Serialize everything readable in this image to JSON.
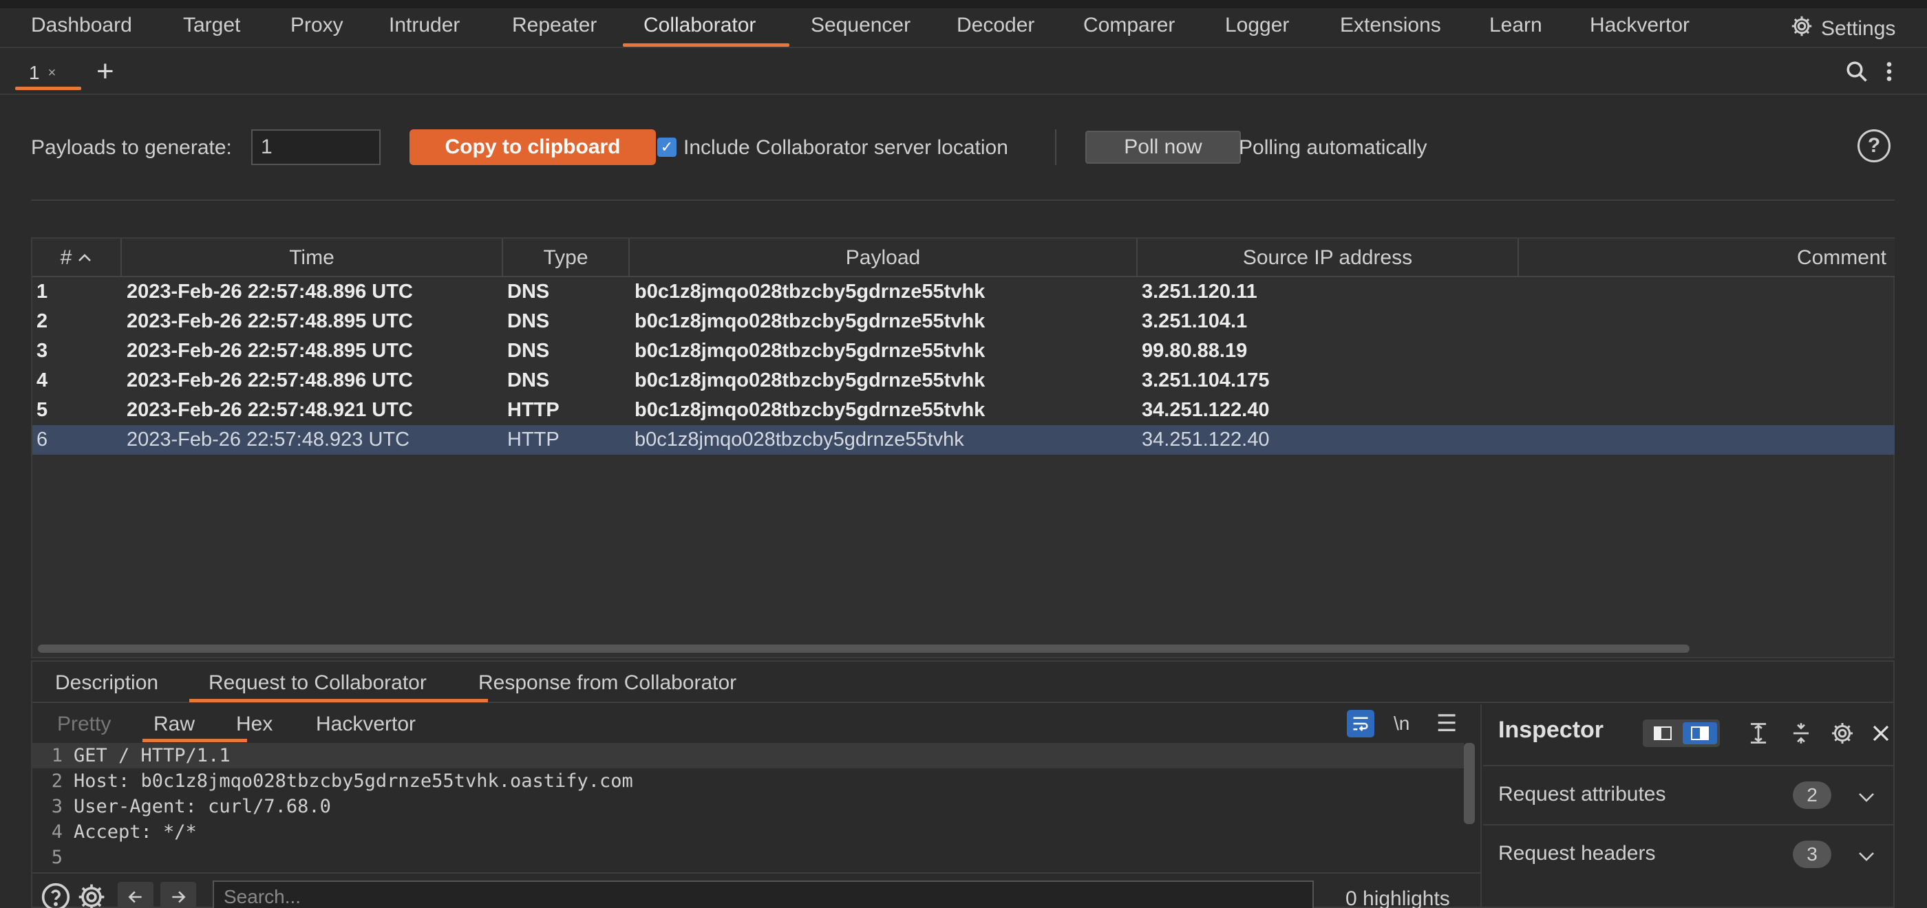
{
  "nav": {
    "tabs": [
      {
        "label": "Dashboard"
      },
      {
        "label": "Target"
      },
      {
        "label": "Proxy"
      },
      {
        "label": "Intruder"
      },
      {
        "label": "Repeater"
      },
      {
        "label": "Collaborator"
      },
      {
        "label": "Sequencer"
      },
      {
        "label": "Decoder"
      },
      {
        "label": "Comparer"
      },
      {
        "label": "Logger"
      },
      {
        "label": "Extensions"
      },
      {
        "label": "Learn"
      },
      {
        "label": "Hackvertor"
      }
    ],
    "active": "Collaborator",
    "settings_label": "Settings"
  },
  "subtab": {
    "label": "1",
    "close": "×",
    "add": "+"
  },
  "toolbar": {
    "payloads_label": "Payloads to generate:",
    "payloads_value": "1",
    "copy_label": "Copy to clipboard",
    "include_label": "Include Collaborator server location",
    "include_checked": true,
    "poll_label": "Poll now",
    "polling_status": "Polling automatically",
    "help": "?"
  },
  "table": {
    "columns": [
      "#",
      "Time",
      "Type",
      "Payload",
      "Source IP address",
      "Comment"
    ],
    "rows": [
      {
        "num": "1",
        "time": "2023-Feb-26 22:57:48.896 UTC",
        "type": "DNS",
        "payload": "b0c1z8jmqo028tbzcby5gdrnze55tvhk",
        "ip": "3.251.120.11",
        "comment": ""
      },
      {
        "num": "2",
        "time": "2023-Feb-26 22:57:48.895 UTC",
        "type": "DNS",
        "payload": "b0c1z8jmqo028tbzcby5gdrnze55tvhk",
        "ip": "3.251.104.1",
        "comment": ""
      },
      {
        "num": "3",
        "time": "2023-Feb-26 22:57:48.895 UTC",
        "type": "DNS",
        "payload": "b0c1z8jmqo028tbzcby5gdrnze55tvhk",
        "ip": "99.80.88.19",
        "comment": ""
      },
      {
        "num": "4",
        "time": "2023-Feb-26 22:57:48.896 UTC",
        "type": "DNS",
        "payload": "b0c1z8jmqo028tbzcby5gdrnze55tvhk",
        "ip": "3.251.104.175",
        "comment": ""
      },
      {
        "num": "5",
        "time": "2023-Feb-26 22:57:48.921 UTC",
        "type": "HTTP",
        "payload": "b0c1z8jmqo028tbzcby5gdrnze55tvhk",
        "ip": "34.251.122.40",
        "comment": ""
      },
      {
        "num": "6",
        "time": "2023-Feb-26 22:57:48.923 UTC",
        "type": "HTTP",
        "payload": "b0c1z8jmqo028tbzcby5gdrnze55tvhk",
        "ip": "34.251.122.40",
        "comment": ""
      }
    ]
  },
  "details": {
    "tabs": [
      "Description",
      "Request to Collaborator",
      "Response from Collaborator"
    ],
    "active": "Request to Collaborator"
  },
  "editor": {
    "tabs": [
      "Pretty",
      "Raw",
      "Hex",
      "Hackvertor"
    ],
    "active": "Raw",
    "newline_toggle": "\\n",
    "lines": [
      {
        "n": "1",
        "text": "GET / HTTP/1.1"
      },
      {
        "n": "2",
        "text": "Host: b0c1z8jmqo028tbzcby5gdrnze55tvhk.oastify.com"
      },
      {
        "n": "3",
        "text": "User-Agent: curl/7.68.0"
      },
      {
        "n": "4",
        "text": "Accept: */*"
      },
      {
        "n": "5",
        "text": ""
      }
    ],
    "search_placeholder": "Search...",
    "highlights": "0 highlights"
  },
  "inspector": {
    "title": "Inspector",
    "sections": [
      {
        "label": "Request attributes",
        "count": "2"
      },
      {
        "label": "Request headers",
        "count": "3"
      }
    ]
  },
  "colors": {
    "accent": "#e8773a",
    "selection": "#3c4a63",
    "primary_button": "#e2642f",
    "blue": "#2f6bbd"
  }
}
